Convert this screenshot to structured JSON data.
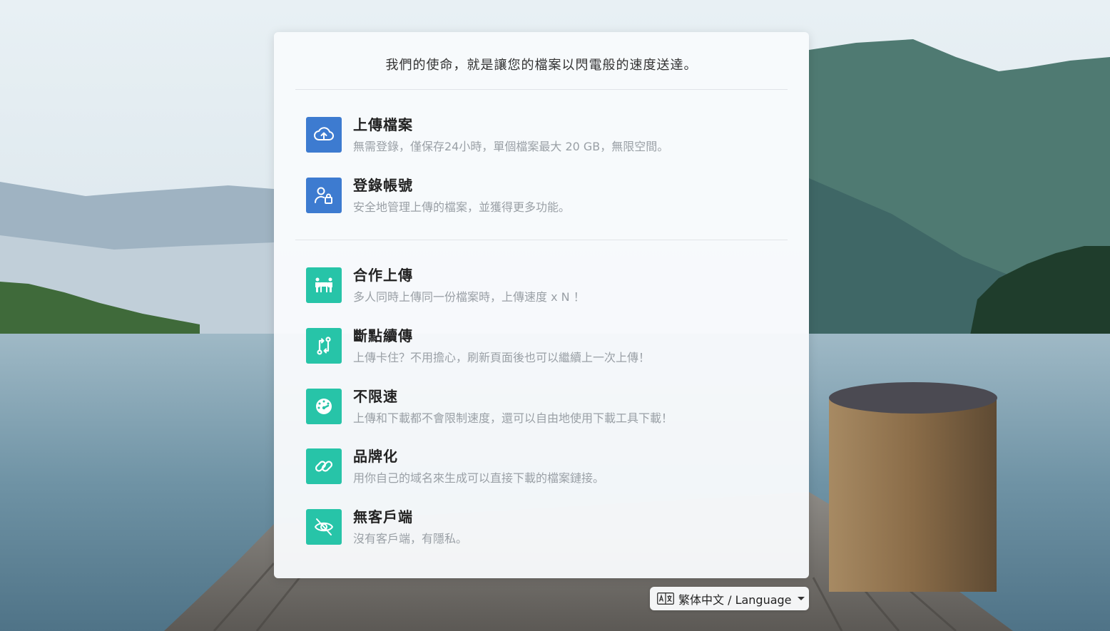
{
  "mission_text": "我們的使命，就是讓您的檔案以閃電般的速度送達。",
  "primary_features": [
    {
      "title": "上傳檔案",
      "description": "無需登錄，僅保存24小時，單個檔案最大 20 GB，無限空間。",
      "icon": "cloud-upload-icon",
      "color": "#3d7bd0"
    },
    {
      "title": "登錄帳號",
      "description": "安全地管理上傳的檔案，並獲得更多功能。",
      "icon": "user-lock-icon",
      "color": "#3d7bd0"
    }
  ],
  "features": [
    {
      "title": "合作上傳",
      "description": "多人同時上傳同一份檔案時，上傳速度 x N ！",
      "icon": "collaboration-icon",
      "color": "#27c4a8"
    },
    {
      "title": "斷點續傳",
      "description": "上傳卡住？不用擔心，刷新頁面後也可以繼續上一次上傳！",
      "icon": "resume-icon",
      "color": "#27c4a8"
    },
    {
      "title": "不限速",
      "description": "上傳和下載都不會限制速度，還可以自由地使用下載工具下載！",
      "icon": "speedometer-icon",
      "color": "#27c4a8"
    },
    {
      "title": "品牌化",
      "description": "用你自己的域名來生成可以直接下載的檔案鏈接。",
      "icon": "link-icon",
      "color": "#27c4a8"
    },
    {
      "title": "無客戶端",
      "description": "沒有客戶端，有隱私。",
      "icon": "eye-slash-icon",
      "color": "#27c4a8"
    }
  ],
  "language_selector": {
    "label": "繁体中文 / Language",
    "icon": "translate-icon"
  }
}
